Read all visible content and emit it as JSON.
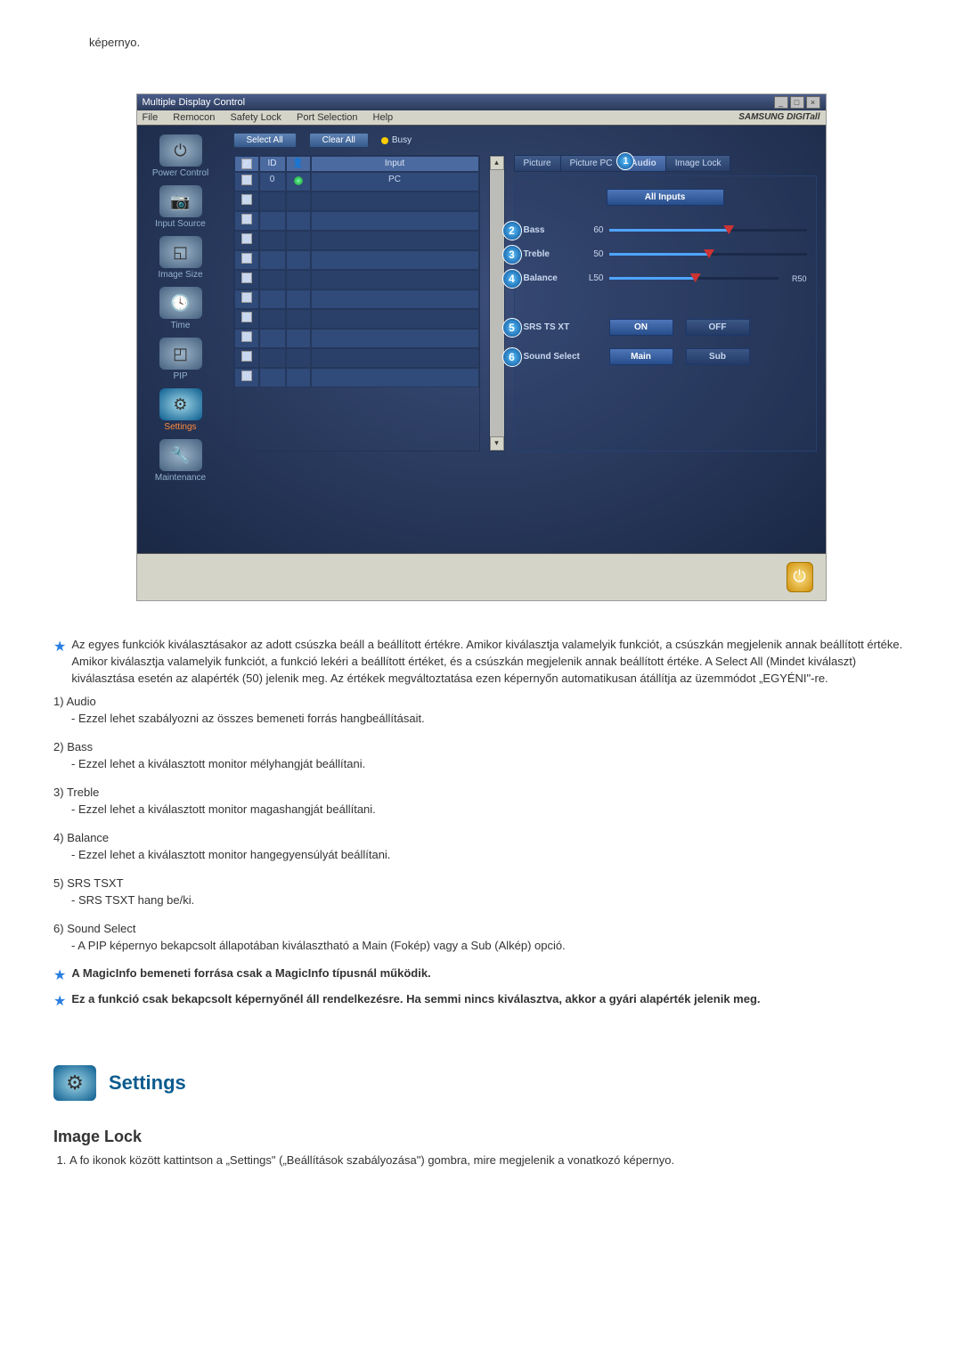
{
  "intro": "képernyo.",
  "app": {
    "title": "Multiple Display Control",
    "menu": [
      "File",
      "Remocon",
      "Safety Lock",
      "Port Selection",
      "Help"
    ],
    "brand": "SAMSUNG DIGITall",
    "buttons": {
      "select_all": "Select All",
      "clear_all": "Clear All",
      "busy": "Busy"
    },
    "sidebar": [
      {
        "label": "Power Control",
        "glyph": "⏻"
      },
      {
        "label": "Input Source",
        "glyph": "📷"
      },
      {
        "label": "Image Size",
        "glyph": "🔲"
      },
      {
        "label": "Time",
        "glyph": "🕓"
      },
      {
        "label": "PIP",
        "glyph": "🖵"
      },
      {
        "label": "Settings",
        "glyph": "⚙",
        "active": true
      },
      {
        "label": "Maintenance",
        "glyph": "🔧"
      }
    ],
    "grid": {
      "headers": [
        "",
        "ID",
        "",
        "Input"
      ],
      "row0": {
        "id": "0",
        "input": "PC"
      }
    },
    "tabs": [
      "Picture",
      "Picture PC",
      "Audio",
      "Image Lock"
    ],
    "active_tab_badge": "1",
    "audio": {
      "all_inputs": "All Inputs",
      "bass": {
        "label": "Bass",
        "value": "60"
      },
      "treble": {
        "label": "Treble",
        "value": "50"
      },
      "balance": {
        "label": "Balance",
        "left": "L50",
        "right": "R50"
      },
      "srs": {
        "label": "SRS TS XT",
        "on": "ON",
        "off": "OFF"
      },
      "sound_select": {
        "label": "Sound Select",
        "main": "Main",
        "sub": "Sub"
      }
    }
  },
  "notes": {
    "star1": "Az egyes funkciók kiválasztásakor az adott csúszka beáll a beállított értékre. Amikor kiválasztja valamelyik funkciót, a csúszkán megjelenik annak beállított értéke. Amikor kiválasztja valamelyik funkciót, a funkció lekéri a beállított értéket, és a csúszkán megjelenik annak beállított értéke. A Select All (Mindet kiválaszt) kiválasztása esetén az alapérték (50) jelenik meg. Az értékek megváltoztatása ezen képernyőn automatikusan átállítja az üzemmódot „EGYÉNI\"-re.",
    "items": [
      {
        "num": "1)",
        "title": "Audio",
        "desc": "- Ezzel lehet szabályozni az összes bemeneti forrás hangbeállításait."
      },
      {
        "num": "2)",
        "title": "Bass",
        "desc": "- Ezzel lehet a kiválasztott monitor mélyhangját beállítani."
      },
      {
        "num": "3)",
        "title": "Treble",
        "desc": "- Ezzel lehet a kiválasztott monitor magashangját beállítani."
      },
      {
        "num": "4)",
        "title": "Balance",
        "desc": "- Ezzel lehet a kiválasztott monitor hangegyensúlyát beállítani."
      },
      {
        "num": "5)",
        "title": "SRS TSXT",
        "desc": "- SRS TSXT hang be/ki."
      },
      {
        "num": "6)",
        "title": "Sound Select",
        "desc": "- A PIP képernyo bekapcsolt állapotában kiválasztható a Main (Fokép) vagy a Sub (Alkép) opció."
      }
    ],
    "star2": "A MagicInfo bemeneti forrása csak a MagicInfo típusnál működik.",
    "star3": "Ez a funkció csak bekapcsolt képernyőnél áll rendelkezésre. Ha semmi nincs kiválasztva, akkor a gyári alapérték jelenik meg."
  },
  "settings_section": {
    "heading": "Settings",
    "subheading": "Image Lock",
    "step1": "A fo ikonok között kattintson a „Settings\" („Beállítások szabályozása\") gombra, mire megjelenik a vonatkozó képernyo."
  }
}
